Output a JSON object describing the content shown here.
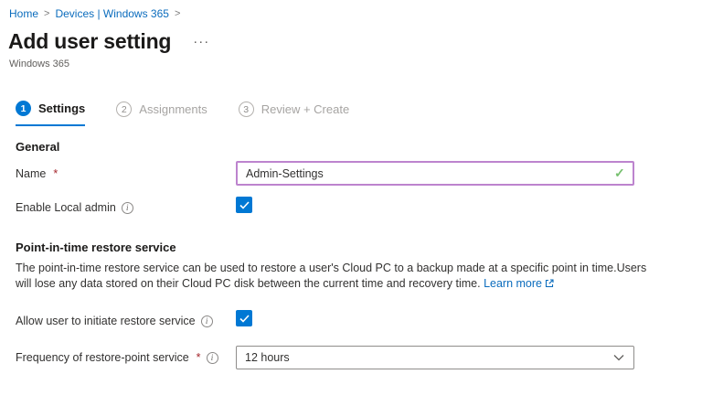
{
  "breadcrumb": {
    "separator": ">",
    "items": [
      {
        "label": "Home"
      },
      {
        "label": "Devices | Windows 365"
      }
    ]
  },
  "header": {
    "title": "Add user setting",
    "more_label": "···",
    "subtitle": "Windows 365"
  },
  "wizard": {
    "steps": [
      {
        "number": "1",
        "label": "Settings"
      },
      {
        "number": "2",
        "label": "Assignments"
      },
      {
        "number": "3",
        "label": "Review + Create"
      }
    ]
  },
  "general": {
    "heading": "General",
    "name_label": "Name",
    "required_marker": "*",
    "name_value": "Admin-Settings",
    "valid_check": "✓",
    "enable_local_admin_label": "Enable Local admin",
    "info_glyph": "i"
  },
  "restore": {
    "heading": "Point-in-time restore service",
    "description": "The point-in-time restore service can be used to restore a user's Cloud PC to a backup made at a specific point in time.Users will lose any data stored on their Cloud PC disk between the current time and recovery time.",
    "learn_more_label": "Learn more",
    "allow_user_label": "Allow user to initiate restore service",
    "frequency_label": "Frequency of restore-point service",
    "frequency_value": "12 hours"
  },
  "colors": {
    "accent_blue": "#0078d4",
    "link_blue": "#0b6cbd",
    "valid_border_purple": "#bd84ce",
    "valid_check_green": "#77c06f",
    "required_red": "#a4262c"
  }
}
